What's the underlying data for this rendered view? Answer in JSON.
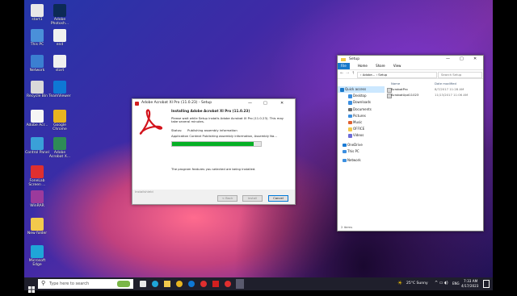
{
  "desktop_icons": [
    {
      "label": "start1",
      "color": "#e8e8e8"
    },
    {
      "label": "This PC",
      "color": "#4a90d9"
    },
    {
      "label": "Network",
      "color": "#3b7fd1"
    },
    {
      "label": "Recycle Bin",
      "color": "#d9d9d9"
    },
    {
      "label": "Adobe Acr...",
      "color": "#f5f5f5"
    },
    {
      "label": "Control Panel",
      "color": "#3aa0d8"
    },
    {
      "label": "FoneLab Screen ...",
      "color": "#e02f2f"
    },
    {
      "label": "WinRAR",
      "color": "#9c3a9c"
    },
    {
      "label": "New folder",
      "color": "#f2c94c"
    },
    {
      "label": "Microsoft Edge",
      "color": "#1fa5d8"
    },
    {
      "label": "Adobe Photosh...",
      "color": "#0c2a55"
    },
    {
      "label": "end",
      "color": "#f0f0f0"
    },
    {
      "label": "start",
      "color": "#f0f0f0"
    },
    {
      "label": "TeamViewer",
      "color": "#0e78d5"
    },
    {
      "label": "Google Chrome",
      "color": "#e8b420"
    },
    {
      "label": "Adobe Acrobat X...",
      "color": "#2e8b57"
    }
  ],
  "installer": {
    "title": "Adobe Acrobat XI Pro (11.0.23) - Setup",
    "heading": "Installing Adobe Acrobat XI Pro (11.0.23)",
    "intro": "Please wait while Setup installs Adobe Acrobat XI Pro (11.0.23). This may take several minutes.",
    "status_label": "Status:",
    "status_value": "Publishing assembly information",
    "detail": "Application Context Publishing assembly information, Assembly Na...",
    "progress": 0.92,
    "footer_note": "The program features you selected are being installed.",
    "brand": "Installshield",
    "buttons": {
      "back": "< Back",
      "install": "Install",
      "cancel": "Cancel"
    },
    "window_controls": [
      "—",
      "□",
      "✕"
    ]
  },
  "explorer": {
    "title": "Setup",
    "ribbon_tabs": [
      "File",
      "Home",
      "Share",
      "View"
    ],
    "breadcrumb": "› Adobe... › Setup",
    "search_placeholder": "Search Setup",
    "quick_access": "Quick access",
    "nav": [
      "Desktop",
      "Downloads",
      "Documents",
      "Pictures",
      "Music",
      "OFFICE",
      "Videos",
      "OneDrive",
      "This PC",
      "Network"
    ],
    "col_name": "Name",
    "col_date": "Date modified",
    "files": [
      {
        "name": "AcrobatPro",
        "date": "8/7/2017 11:28 AM"
      },
      {
        "name": "AcrobatUpd11023",
        "date": "11/13/2017 11:06 AM"
      }
    ],
    "status": "2 items"
  },
  "taskbar": {
    "search_placeholder": "Type here to search",
    "weather": "25°C  Sunny",
    "time": "7:33 AM",
    "date": "4/17/2023",
    "lang": "ENG"
  }
}
